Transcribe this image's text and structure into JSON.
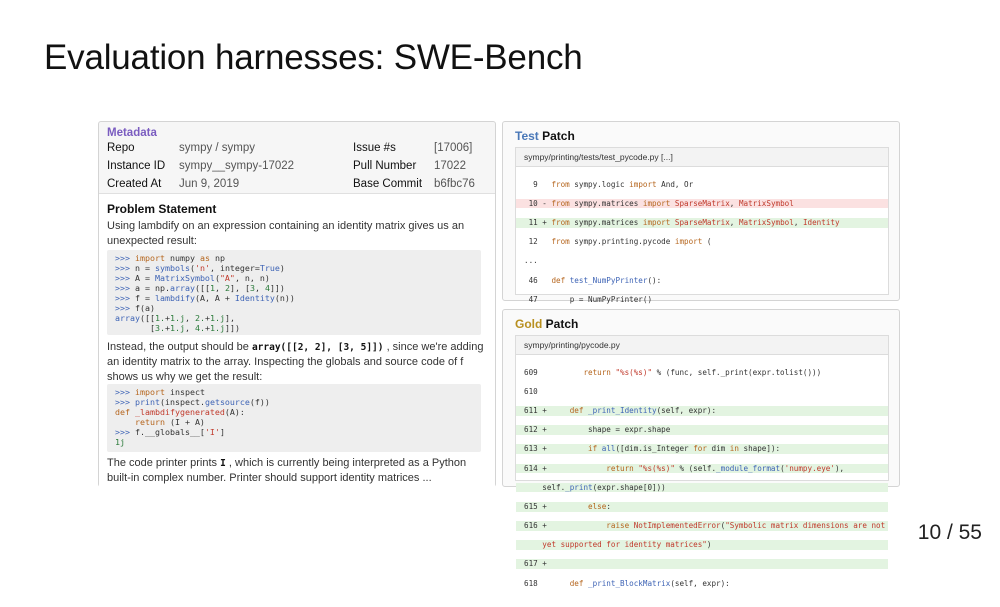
{
  "slide": {
    "title": "Evaluation harnesses: SWE-Bench",
    "page": "10 / 55"
  },
  "metadata": {
    "title": "Metadata",
    "repo_label": "Repo",
    "repo_value": "sympy / sympy",
    "instance_label": "Instance ID",
    "instance_value": "sympy__sympy-17022",
    "created_label": "Created At",
    "created_value": "Jun 9, 2019",
    "issue_label": "Issue #s",
    "issue_value": "[17006]",
    "pull_label": "Pull Number",
    "pull_value": "17022",
    "base_label": "Base Commit",
    "base_value": "b6fbc76"
  },
  "problem": {
    "title": "Problem Statement",
    "para1": "Using lambdify on an expression containing an identity matrix gives us an unexpected result:",
    "para2_a": "Instead, the output should be ",
    "para2_code": "array([[2, 2], [3, 5]])",
    "para2_b": " , since we're adding an identity matrix to the array. Inspecting the globals and source code of f shows us why we get the result:",
    "para3_a": "The code printer prints ",
    "para3_code": "I",
    "para3_b": " , which is currently being interpreted as a Python built-in complex number. Printer should support identity matrices ..."
  },
  "test_patch": {
    "title_accent": "Test",
    "title_rest": " Patch",
    "path": "sympy/printing/tests/test_pycode.py  [...]",
    "accent_color": "#4a78b8"
  },
  "gold_patch": {
    "title_accent": "Gold",
    "title_rest": " Patch",
    "path": "sympy/printing/pycode.py",
    "accent_color": "#b89020"
  }
}
